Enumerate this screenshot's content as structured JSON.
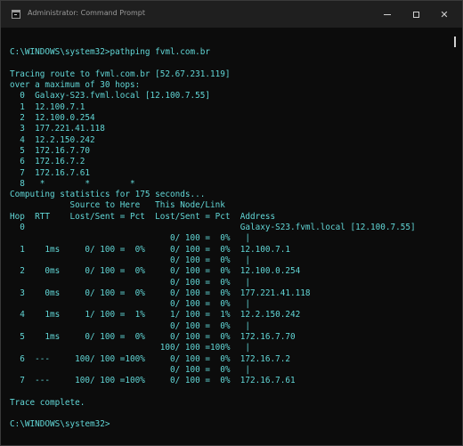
{
  "window": {
    "title": "Administrator: Command Prompt",
    "icon": "cmd-icon",
    "controls": {
      "minimize_icon": "minimize-icon",
      "maximize_icon": "maximize-icon",
      "close_symbol": "✕"
    }
  },
  "console": {
    "lines": [
      "",
      "C:\\WINDOWS\\system32>pathping fvml.com.br",
      "",
      "Tracing route to fvml.com.br [52.67.231.119]",
      "over a maximum of 30 hops:",
      "  0  Galaxy-S23.fvml.local [12.100.7.55]",
      "  1  12.100.7.1",
      "  2  12.100.0.254",
      "  3  177.221.41.118",
      "  4  12.2.150.242",
      "  5  172.16.7.70",
      "  6  172.16.7.2",
      "  7  172.16.7.61",
      "  8   *        *        *",
      "Computing statistics for 175 seconds...",
      "            Source to Here   This Node/Link",
      "Hop  RTT    Lost/Sent = Pct  Lost/Sent = Pct  Address",
      "  0                                           Galaxy-S23.fvml.local [12.100.7.55]",
      "                                0/ 100 =  0%   |",
      "  1    1ms     0/ 100 =  0%     0/ 100 =  0%  12.100.7.1",
      "                                0/ 100 =  0%   |",
      "  2    0ms     0/ 100 =  0%     0/ 100 =  0%  12.100.0.254",
      "                                0/ 100 =  0%   |",
      "  3    0ms     0/ 100 =  0%     0/ 100 =  0%  177.221.41.118",
      "                                0/ 100 =  0%   |",
      "  4    1ms     1/ 100 =  1%     1/ 100 =  1%  12.2.150.242",
      "                                0/ 100 =  0%   |",
      "  5    1ms     0/ 100 =  0%     0/ 100 =  0%  172.16.7.70",
      "                              100/ 100 =100%   |",
      "  6  ---     100/ 100 =100%     0/ 100 =  0%  172.16.7.2",
      "                                0/ 100 =  0%   |",
      "  7  ---     100/ 100 =100%     0/ 100 =  0%  172.16.7.61",
      "",
      "Trace complete.",
      "",
      "C:\\WINDOWS\\system32>"
    ],
    "text_color": "#61d6d6",
    "background_color": "#0c0c0c"
  }
}
